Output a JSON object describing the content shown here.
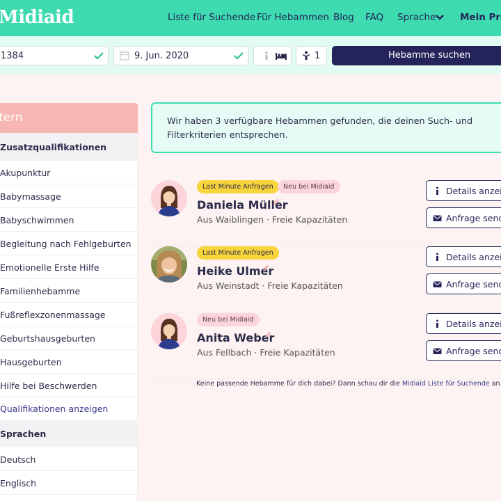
{
  "header": {
    "logo": "Midiaid",
    "nav": [
      "Liste für Suchende",
      "Für Hebammen",
      "Blog",
      "FAQ",
      "Sprache",
      "Mein Profi"
    ]
  },
  "search": {
    "postcode": "1384",
    "date": "9. Jun. 2020",
    "count": "1",
    "button": "Hebamme suchen"
  },
  "sidebar": {
    "title": "tern",
    "sections": [
      {
        "title": "Zusatzqualifikationen",
        "items": [
          "Akupunktur",
          "Babymassage",
          "Babyschwimmen",
          "Begleitung nach Fehlgeburten",
          "Emotionelle Erste Hilfe",
          "Familienhebamme",
          "Fußreflexzonenmassage",
          "Geburtshausgeburten",
          "Hausgeburten",
          "Hilfe bei Beschwerden"
        ],
        "more_link": "Qualifikationen anzeigen"
      },
      {
        "title": "Sprachen",
        "items": [
          "Deutsch",
          "Englisch"
        ]
      }
    ]
  },
  "results": {
    "info": "Wir haben 3 verfügbare Hebammen gefunden, die deinen Such- und Filterkriterien entsprechen.",
    "details_label": "Details anzeig",
    "request_label": "Anfrage send",
    "midwives": [
      {
        "name": "Daniela Müller",
        "location": "Aus Waiblingen · Freie Kapazitäten",
        "badges": [
          "Last Minute Anfragen",
          "Neu bei Midiaid"
        ]
      },
      {
        "name": "Heike Ulmer",
        "location": "Aus Weinstadt · Freie Kapazitäten",
        "badges": [
          "Last Minute Anfragen"
        ]
      },
      {
        "name": "Anita Weber",
        "location": "Aus Fellbach · Freie Kapazitäten",
        "badges": [
          "Neu bei Midiaid"
        ]
      }
    ],
    "footnote_text": "Keine passende Hebamme für dich dabei? Dann schau dir die ",
    "footnote_link": "Midiaid Liste für Suchende",
    "footnote_end": " an."
  },
  "colors": {
    "brand": "#3ddbaf",
    "navy": "#24245a",
    "sidebar_head": "#f8b6b3",
    "badge_yellow": "#f8d43b",
    "badge_pink": "#fbd5da",
    "check": "#2bc48a"
  },
  "icons": [
    "check-icon",
    "calendar-icon",
    "person-icon",
    "bed-icon",
    "baby-icon",
    "chevron-down-icon",
    "info-icon",
    "envelope-icon",
    "link-icon"
  ]
}
